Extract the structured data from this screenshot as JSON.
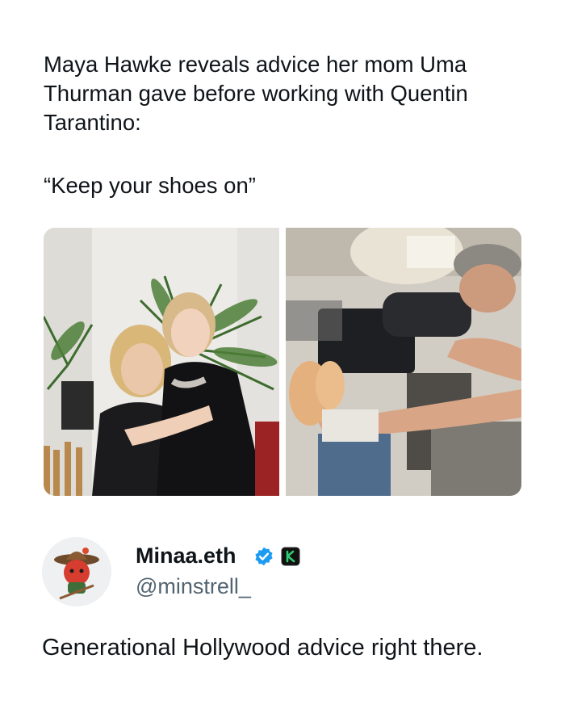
{
  "post": {
    "headline": "Maya Hawke reveals advice her mom Uma Thurman gave before working with Quentin Tarantino:",
    "quote": "“Keep your shoes on”"
  },
  "media": {
    "left_photo": "two-women-hugging-photo",
    "right_photo": "director-behind-camera-photo"
  },
  "author": {
    "display_name": "Minaa.eth",
    "handle": "@minstrell_",
    "badges": [
      "verified-icon",
      "affiliate-badge-icon"
    ],
    "verified_color": "#1d9bf0"
  },
  "reply": {
    "text": "Generational Hollywood advice right there."
  }
}
